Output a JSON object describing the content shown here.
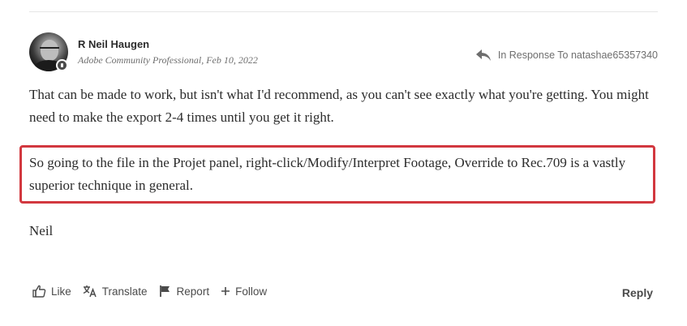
{
  "author": {
    "name": "R Neil Haugen",
    "meta": "Adobe Community Professional, Feb 10, 2022"
  },
  "in_response": {
    "label": "In Response To natashae65357340",
    "icon": "reply-arrow-icon"
  },
  "body": {
    "paragraph1": "That can be made to work, but isn't what I'd recommend, as you can't see exactly what you're getting. You might need to make the export 2-4 times until you get it right.",
    "paragraph2": "So going to the file in the Projet panel, right-click/Modify/Interpret Footage, Override to Rec.709 is a vastly superior technique in general.",
    "signature": "Neil"
  },
  "actions": {
    "like": "Like",
    "translate": "Translate",
    "report": "Report",
    "follow": "Follow",
    "reply": "Reply"
  },
  "colors": {
    "highlight_border": "#d2383f",
    "text": "#2c2c2c",
    "muted": "#6e6e6e"
  }
}
